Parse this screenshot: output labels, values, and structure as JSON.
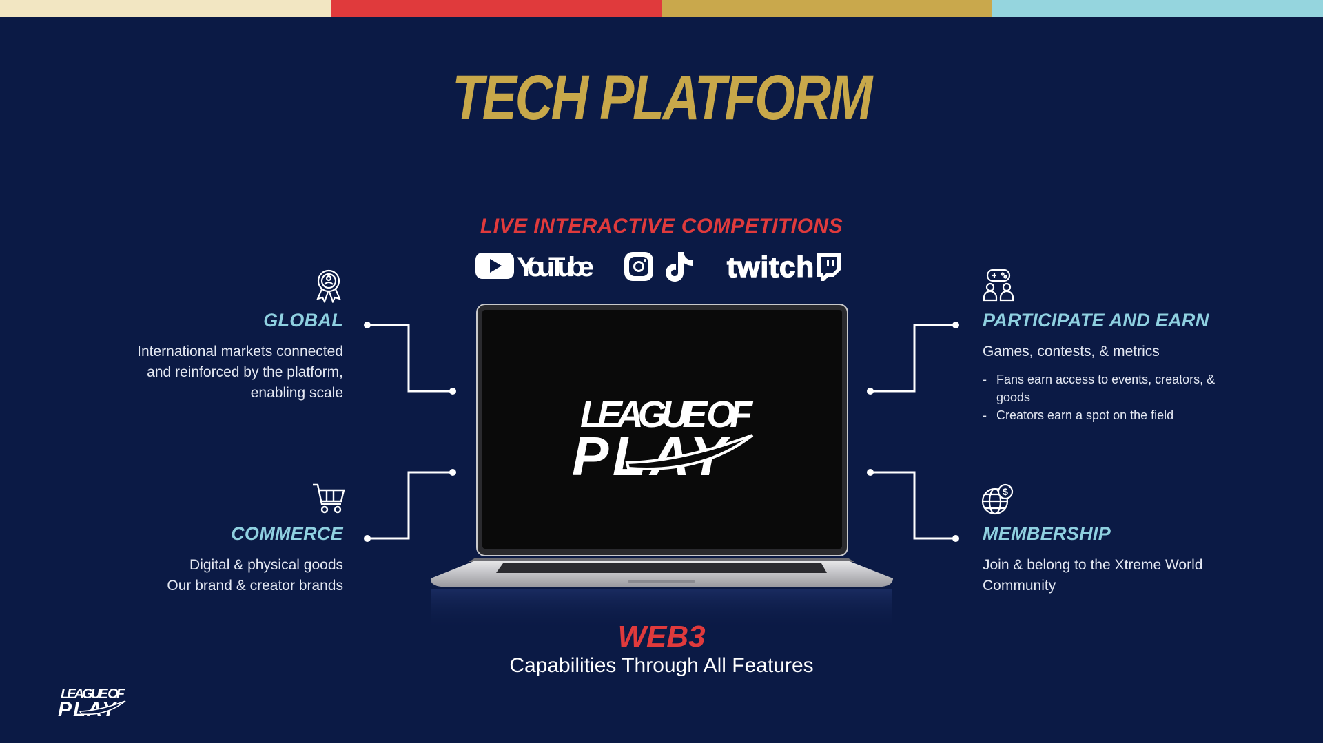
{
  "colors": {
    "background": "#0b1a45",
    "title": "#c8a84a",
    "accent_red": "#e03a3c",
    "feature_blue": "#8fd0e0",
    "stripes": [
      "#f2e6c2",
      "#e03a3c",
      "#c9a84c",
      "#95d5de"
    ]
  },
  "title": "TECH PLATFORM",
  "live_heading": "LIVE INTERACTIVE COMPETITIONS",
  "platforms": {
    "youtube": "YouTube",
    "twitch": "twitch"
  },
  "laptop": {
    "logo_line1": "LEAGUE OF",
    "logo_line2": "PLAY"
  },
  "features": {
    "global": {
      "icon": "award-ribbon-icon",
      "title": "GLOBAL",
      "lines": [
        "International markets connected",
        "and reinforced by the platform,",
        "enabling scale"
      ]
    },
    "commerce": {
      "icon": "shopping-cart-icon",
      "title": "COMMERCE",
      "lines": [
        "Digital & physical goods",
        "Our brand & creator brands"
      ]
    },
    "participate": {
      "icon": "gamepad-users-icon",
      "title": "PARTICIPATE AND EARN",
      "text": "Games, contests, & metrics",
      "bullets": [
        "Fans earn access to events, creators, & goods",
        "Creators earn a spot on the field"
      ]
    },
    "membership": {
      "icon": "globe-dollar-icon",
      "title": "MEMBERSHIP",
      "lines": [
        "Join & belong to the Xtreme World",
        "Community"
      ]
    }
  },
  "web3": {
    "title": "WEB3",
    "subtitle": "Capabilities Through All Features"
  },
  "corner_logo": {
    "line1": "LEAGUE OF",
    "line2": "PLAY"
  }
}
